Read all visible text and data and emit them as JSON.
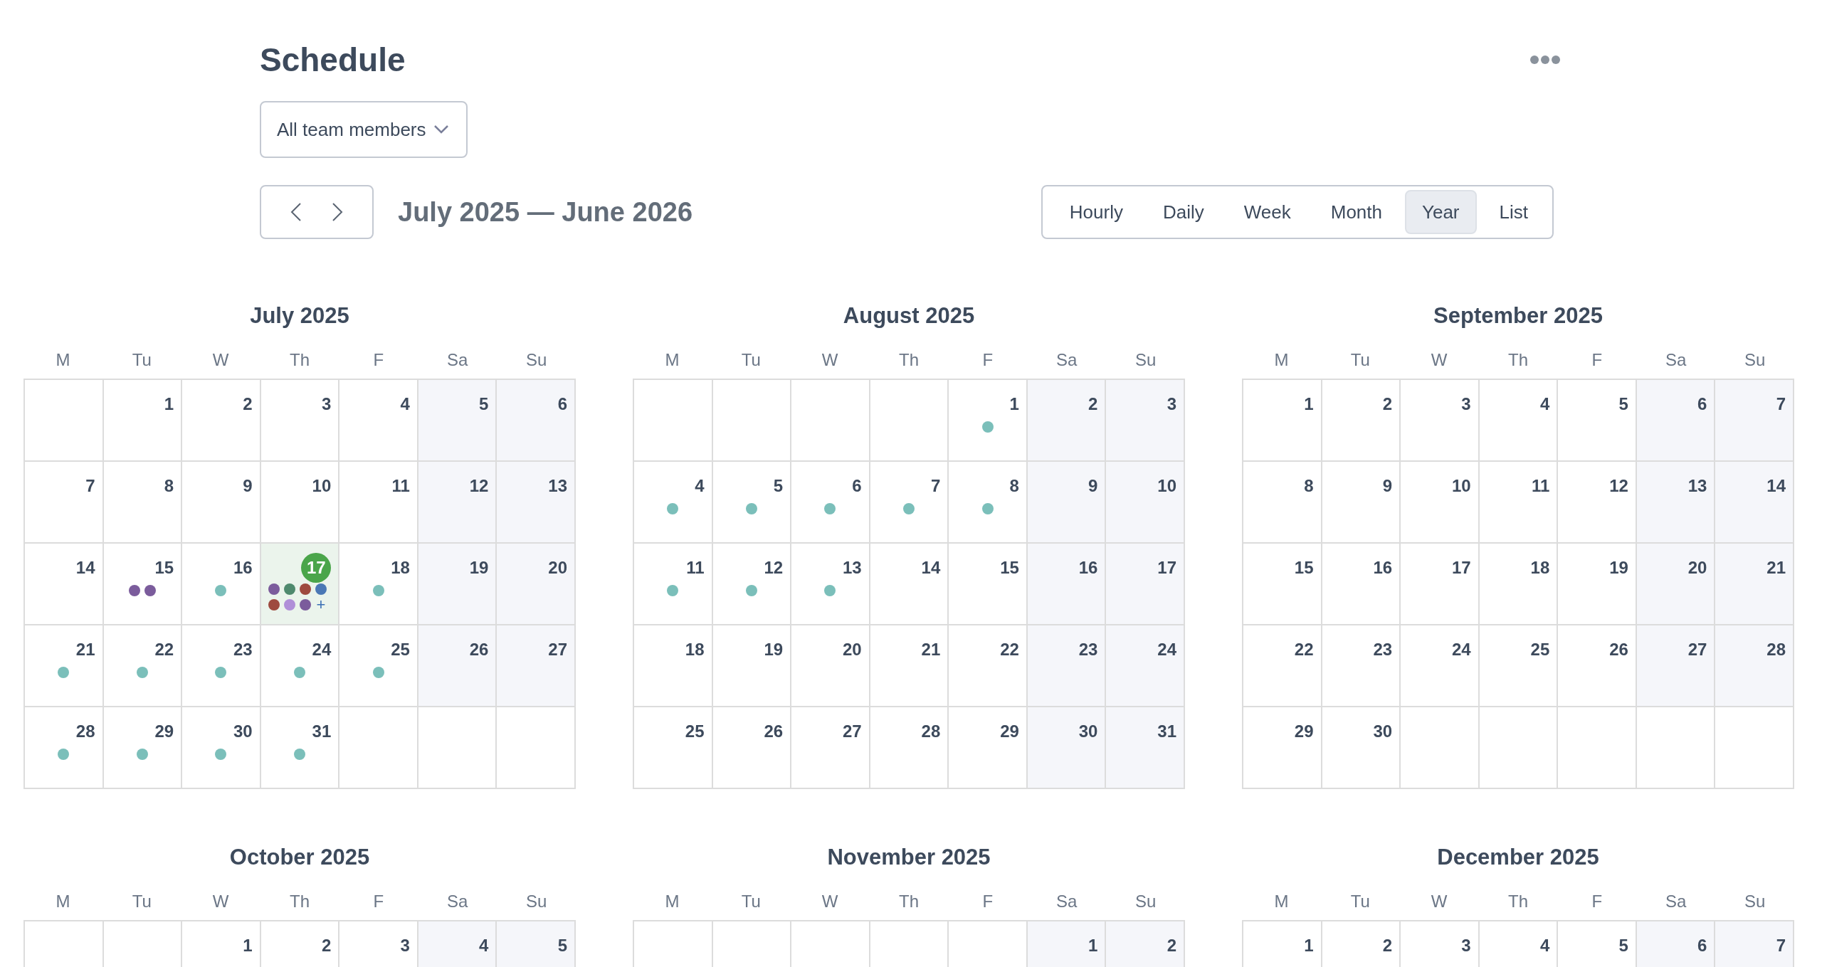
{
  "title": "Schedule",
  "filter": {
    "value": "All team members"
  },
  "range": "July 2025 — June 2026",
  "views": [
    {
      "label": "Hourly",
      "selected": false
    },
    {
      "label": "Daily",
      "selected": false
    },
    {
      "label": "Week",
      "selected": false
    },
    {
      "label": "Month",
      "selected": false
    },
    {
      "label": "Year",
      "selected": true
    },
    {
      "label": "List",
      "selected": false
    }
  ],
  "months": [
    {
      "title": "July 2025",
      "weekdays": [
        "M",
        "Tu",
        "W",
        "Th",
        "F",
        "Sa",
        "Su"
      ],
      "weeks": [
        [
          {
            "kind": "blank"
          },
          {
            "kind": "day",
            "n": "1",
            "today": false
          },
          {
            "kind": "day",
            "n": "2",
            "today": false
          },
          {
            "kind": "day",
            "n": "3",
            "today": false
          },
          {
            "kind": "day",
            "n": "4",
            "today": false
          },
          {
            "kind": "day",
            "n": "5",
            "today": false
          },
          {
            "kind": "day",
            "n": "6",
            "today": false
          }
        ],
        [
          {
            "kind": "day",
            "n": "7",
            "today": false
          },
          {
            "kind": "day",
            "n": "8",
            "today": false
          },
          {
            "kind": "day",
            "n": "9",
            "today": false
          },
          {
            "kind": "day",
            "n": "10",
            "today": false
          },
          {
            "kind": "day",
            "n": "11",
            "today": false
          },
          {
            "kind": "day",
            "n": "12",
            "today": false
          },
          {
            "kind": "day",
            "n": "13",
            "today": false
          }
        ],
        [
          {
            "kind": "day",
            "n": "14",
            "today": false
          },
          {
            "kind": "day",
            "n": "15",
            "today": false,
            "dots": [
              {
                "color": "#7b5c9c"
              },
              {
                "color": "#7b5c9c"
              }
            ]
          },
          {
            "kind": "day",
            "n": "16",
            "today": false,
            "dots": [
              {
                "color": "#7bbfba"
              }
            ]
          },
          {
            "kind": "day",
            "n": "17",
            "today": true,
            "dots": [
              {
                "color": "#7b5c9c"
              },
              {
                "color": "#4f8a6e"
              },
              {
                "color": "#9e4a3f"
              },
              {
                "color": "#4a78b5"
              },
              {
                "color": "#9e4a3f"
              },
              {
                "color": "#b08fd8"
              },
              {
                "color": "#7b5c9c"
              }
            ],
            "more": "+"
          },
          {
            "kind": "day",
            "n": "18",
            "today": false,
            "dots": [
              {
                "color": "#7bbfba"
              }
            ]
          },
          {
            "kind": "day",
            "n": "19",
            "today": false
          },
          {
            "kind": "day",
            "n": "20",
            "today": false
          }
        ],
        [
          {
            "kind": "day",
            "n": "21",
            "today": false,
            "dots": [
              {
                "color": "#7bbfba"
              }
            ]
          },
          {
            "kind": "day",
            "n": "22",
            "today": false,
            "dots": [
              {
                "color": "#7bbfba"
              }
            ]
          },
          {
            "kind": "day",
            "n": "23",
            "today": false,
            "dots": [
              {
                "color": "#7bbfba"
              }
            ]
          },
          {
            "kind": "day",
            "n": "24",
            "today": false,
            "dots": [
              {
                "color": "#7bbfba"
              }
            ]
          },
          {
            "kind": "day",
            "n": "25",
            "today": false,
            "dots": [
              {
                "color": "#7bbfba"
              }
            ]
          },
          {
            "kind": "day",
            "n": "26",
            "today": false
          },
          {
            "kind": "day",
            "n": "27",
            "today": false
          }
        ],
        [
          {
            "kind": "day",
            "n": "28",
            "today": false,
            "dots": [
              {
                "color": "#7bbfba"
              }
            ]
          },
          {
            "kind": "day",
            "n": "29",
            "today": false,
            "dots": [
              {
                "color": "#7bbfba"
              }
            ]
          },
          {
            "kind": "day",
            "n": "30",
            "today": false,
            "dots": [
              {
                "color": "#7bbfba"
              }
            ]
          },
          {
            "kind": "day",
            "n": "31",
            "today": false,
            "dots": [
              {
                "color": "#7bbfba"
              }
            ]
          },
          {
            "kind": "blank"
          },
          {
            "kind": "blank"
          },
          {
            "kind": "blank"
          }
        ]
      ]
    },
    {
      "title": "August 2025",
      "weekdays": [
        "M",
        "Tu",
        "W",
        "Th",
        "F",
        "Sa",
        "Su"
      ],
      "weeks": [
        [
          {
            "kind": "blank"
          },
          {
            "kind": "blank"
          },
          {
            "kind": "blank"
          },
          {
            "kind": "blank"
          },
          {
            "kind": "day",
            "n": "1",
            "today": false,
            "dots": [
              {
                "color": "#7bbfba"
              }
            ]
          },
          {
            "kind": "day",
            "n": "2",
            "today": false
          },
          {
            "kind": "day",
            "n": "3",
            "today": false
          }
        ],
        [
          {
            "kind": "day",
            "n": "4",
            "today": false,
            "dots": [
              {
                "color": "#7bbfba"
              }
            ]
          },
          {
            "kind": "day",
            "n": "5",
            "today": false,
            "dots": [
              {
                "color": "#7bbfba"
              }
            ]
          },
          {
            "kind": "day",
            "n": "6",
            "today": false,
            "dots": [
              {
                "color": "#7bbfba"
              }
            ]
          },
          {
            "kind": "day",
            "n": "7",
            "today": false,
            "dots": [
              {
                "color": "#7bbfba"
              }
            ]
          },
          {
            "kind": "day",
            "n": "8",
            "today": false,
            "dots": [
              {
                "color": "#7bbfba"
              }
            ]
          },
          {
            "kind": "day",
            "n": "9",
            "today": false
          },
          {
            "kind": "day",
            "n": "10",
            "today": false
          }
        ],
        [
          {
            "kind": "day",
            "n": "11",
            "today": false,
            "dots": [
              {
                "color": "#7bbfba"
              }
            ]
          },
          {
            "kind": "day",
            "n": "12",
            "today": false,
            "dots": [
              {
                "color": "#7bbfba"
              }
            ]
          },
          {
            "kind": "day",
            "n": "13",
            "today": false,
            "dots": [
              {
                "color": "#7bbfba"
              }
            ]
          },
          {
            "kind": "day",
            "n": "14",
            "today": false
          },
          {
            "kind": "day",
            "n": "15",
            "today": false
          },
          {
            "kind": "day",
            "n": "16",
            "today": false
          },
          {
            "kind": "day",
            "n": "17",
            "today": false
          }
        ],
        [
          {
            "kind": "day",
            "n": "18",
            "today": false
          },
          {
            "kind": "day",
            "n": "19",
            "today": false
          },
          {
            "kind": "day",
            "n": "20",
            "today": false
          },
          {
            "kind": "day",
            "n": "21",
            "today": false
          },
          {
            "kind": "day",
            "n": "22",
            "today": false
          },
          {
            "kind": "day",
            "n": "23",
            "today": false
          },
          {
            "kind": "day",
            "n": "24",
            "today": false
          }
        ],
        [
          {
            "kind": "day",
            "n": "25",
            "today": false
          },
          {
            "kind": "day",
            "n": "26",
            "today": false
          },
          {
            "kind": "day",
            "n": "27",
            "today": false
          },
          {
            "kind": "day",
            "n": "28",
            "today": false
          },
          {
            "kind": "day",
            "n": "29",
            "today": false
          },
          {
            "kind": "day",
            "n": "30",
            "today": false
          },
          {
            "kind": "day",
            "n": "31",
            "today": false
          }
        ]
      ]
    },
    {
      "title": "September 2025",
      "weekdays": [
        "M",
        "Tu",
        "W",
        "Th",
        "F",
        "Sa",
        "Su"
      ],
      "weeks": [
        [
          {
            "kind": "day",
            "n": "1",
            "today": false
          },
          {
            "kind": "day",
            "n": "2",
            "today": false
          },
          {
            "kind": "day",
            "n": "3",
            "today": false
          },
          {
            "kind": "day",
            "n": "4",
            "today": false
          },
          {
            "kind": "day",
            "n": "5",
            "today": false
          },
          {
            "kind": "day",
            "n": "6",
            "today": false
          },
          {
            "kind": "day",
            "n": "7",
            "today": false
          }
        ],
        [
          {
            "kind": "day",
            "n": "8",
            "today": false
          },
          {
            "kind": "day",
            "n": "9",
            "today": false
          },
          {
            "kind": "day",
            "n": "10",
            "today": false
          },
          {
            "kind": "day",
            "n": "11",
            "today": false
          },
          {
            "kind": "day",
            "n": "12",
            "today": false
          },
          {
            "kind": "day",
            "n": "13",
            "today": false
          },
          {
            "kind": "day",
            "n": "14",
            "today": false
          }
        ],
        [
          {
            "kind": "day",
            "n": "15",
            "today": false
          },
          {
            "kind": "day",
            "n": "16",
            "today": false
          },
          {
            "kind": "day",
            "n": "17",
            "today": false
          },
          {
            "kind": "day",
            "n": "18",
            "today": false
          },
          {
            "kind": "day",
            "n": "19",
            "today": false
          },
          {
            "kind": "day",
            "n": "20",
            "today": false
          },
          {
            "kind": "day",
            "n": "21",
            "today": false
          }
        ],
        [
          {
            "kind": "day",
            "n": "22",
            "today": false
          },
          {
            "kind": "day",
            "n": "23",
            "today": false
          },
          {
            "kind": "day",
            "n": "24",
            "today": false
          },
          {
            "kind": "day",
            "n": "25",
            "today": false
          },
          {
            "kind": "day",
            "n": "26",
            "today": false
          },
          {
            "kind": "day",
            "n": "27",
            "today": false
          },
          {
            "kind": "day",
            "n": "28",
            "today": false
          }
        ],
        [
          {
            "kind": "day",
            "n": "29",
            "today": false
          },
          {
            "kind": "day",
            "n": "30",
            "today": false
          },
          {
            "kind": "blank"
          },
          {
            "kind": "blank"
          },
          {
            "kind": "blank"
          },
          {
            "kind": "blank"
          },
          {
            "kind": "blank"
          }
        ]
      ]
    },
    {
      "title": "October 2025",
      "weekdays": [
        "M",
        "Tu",
        "W",
        "Th",
        "F",
        "Sa",
        "Su"
      ],
      "weeks": [
        [
          {
            "kind": "blank"
          },
          {
            "kind": "blank"
          },
          {
            "kind": "day",
            "n": "1",
            "today": false
          },
          {
            "kind": "day",
            "n": "2",
            "today": false
          },
          {
            "kind": "day",
            "n": "3",
            "today": false
          },
          {
            "kind": "day",
            "n": "4",
            "today": false
          },
          {
            "kind": "day",
            "n": "5",
            "today": false
          }
        ]
      ]
    },
    {
      "title": "November 2025",
      "weekdays": [
        "M",
        "Tu",
        "W",
        "Th",
        "F",
        "Sa",
        "Su"
      ],
      "weeks": [
        [
          {
            "kind": "blank"
          },
          {
            "kind": "blank"
          },
          {
            "kind": "blank"
          },
          {
            "kind": "blank"
          },
          {
            "kind": "blank"
          },
          {
            "kind": "day",
            "n": "1",
            "today": false
          },
          {
            "kind": "day",
            "n": "2",
            "today": false
          }
        ]
      ]
    },
    {
      "title": "December 2025",
      "weekdays": [
        "M",
        "Tu",
        "W",
        "Th",
        "F",
        "Sa",
        "Su"
      ],
      "weeks": [
        [
          {
            "kind": "day",
            "n": "1",
            "today": false
          },
          {
            "kind": "day",
            "n": "2",
            "today": false
          },
          {
            "kind": "day",
            "n": "3",
            "today": false
          },
          {
            "kind": "day",
            "n": "4",
            "today": false
          },
          {
            "kind": "day",
            "n": "5",
            "today": false
          },
          {
            "kind": "day",
            "n": "6",
            "today": false
          },
          {
            "kind": "day",
            "n": "7",
            "today": false
          }
        ]
      ]
    }
  ]
}
